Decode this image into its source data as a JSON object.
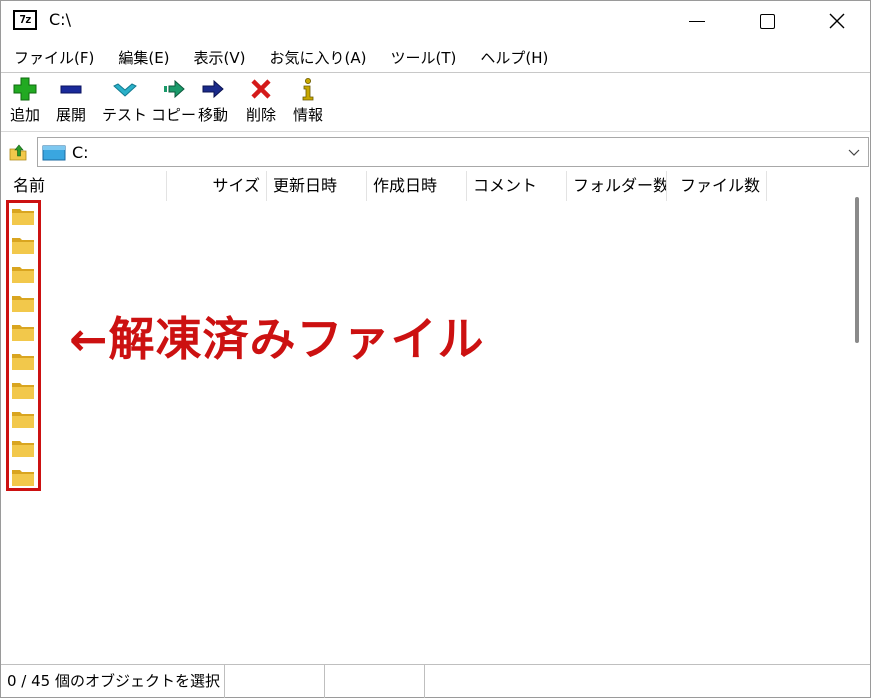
{
  "window": {
    "title": "C:\\",
    "app_icon_text": "7z"
  },
  "menu": [
    "ファイル(F)",
    "編集(E)",
    "表示(V)",
    "お気に入り(A)",
    "ツール(T)",
    "ヘルプ(H)"
  ],
  "toolbar": {
    "add": {
      "label": "追加",
      "icon": "plus-icon",
      "color": "#22aa22"
    },
    "extract": {
      "label": "展開",
      "icon": "minus-icon",
      "color": "#1a2a9a"
    },
    "test": {
      "label": "テスト",
      "icon": "check-icon",
      "color": "#2ab0c8"
    },
    "copy": {
      "label": "コピー",
      "icon": "arrow-right-icon",
      "color": "#1a9a6a"
    },
    "move": {
      "label": "移動",
      "icon": "arrow-right-icon",
      "color": "#1a2a8a"
    },
    "delete": {
      "label": "削除",
      "icon": "x-icon",
      "color": "#d41a1a"
    },
    "info": {
      "label": "情報",
      "icon": "info-icon",
      "color": "#c8a800"
    }
  },
  "address": {
    "path": "C:"
  },
  "columns": [
    "名前",
    "サイズ",
    "更新日時",
    "作成日時",
    "コメント",
    "フォルダー数",
    "ファイル数"
  ],
  "folder_rows": 10,
  "annotation": {
    "text": "←解凍済みファイル",
    "color": "#cc1111"
  },
  "status": {
    "selection": "0 / 45 個のオブジェクトを選択"
  },
  "colors": {
    "folder": "#f2c84b",
    "folder_dark": "#d9a520"
  }
}
